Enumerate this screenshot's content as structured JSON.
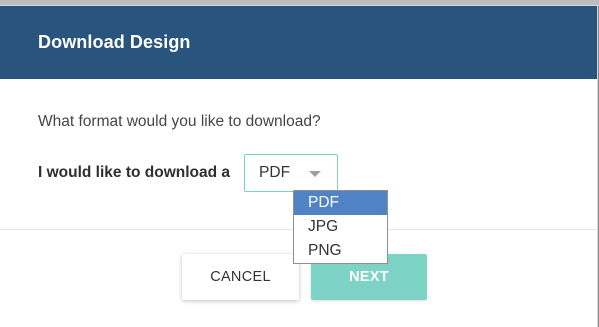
{
  "dialog": {
    "title": "Download Design",
    "question": "What format would you like to download?",
    "format_label": "I would like to download a",
    "selected_format": "PDF",
    "cancel_label": "CANCEL",
    "next_label": "NEXT"
  },
  "dropdown": {
    "options": [
      "PDF",
      "JPG",
      "PNG"
    ],
    "highlighted_index": 0
  },
  "icons": {
    "select_caret": "chevron-down-icon"
  },
  "colors": {
    "header_bg": "#29547e",
    "accent_teal": "#7dd3c6",
    "option_highlight": "#4f83c6"
  }
}
